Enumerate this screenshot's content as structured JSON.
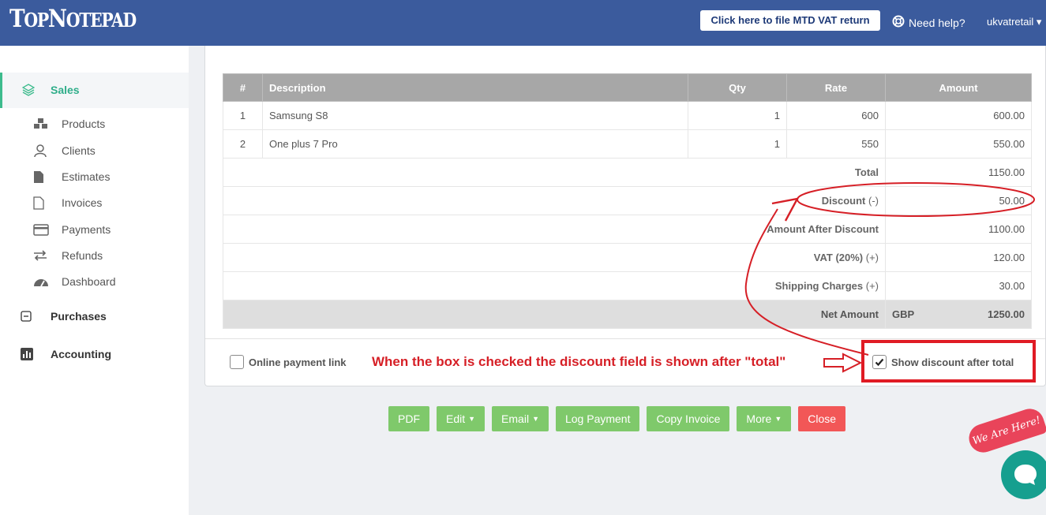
{
  "header": {
    "logo_big": "T",
    "logo_small1": "OP",
    "logo_big2": "N",
    "logo_small2": "OTEPAD",
    "mtd_button": "Click here to file MTD VAT return",
    "help": "Need help?",
    "user": "ukvatretail"
  },
  "sidebar": {
    "active": "Sales",
    "items": [
      {
        "label": "Products",
        "icon": "cubes-icon"
      },
      {
        "label": "Clients",
        "icon": "user-icon"
      },
      {
        "label": "Estimates",
        "icon": "file-icon"
      },
      {
        "label": "Invoices",
        "icon": "file-outline-icon"
      },
      {
        "label": "Payments",
        "icon": "credit-card-icon"
      },
      {
        "label": "Refunds",
        "icon": "exchange-icon"
      },
      {
        "label": "Dashboard",
        "icon": "dashboard-icon"
      }
    ],
    "sections": [
      {
        "label": "Purchases",
        "icon": "minus-square-icon"
      },
      {
        "label": "Accounting",
        "icon": "bar-chart-icon"
      }
    ]
  },
  "table": {
    "headers": {
      "num": "#",
      "desc": "Description",
      "qty": "Qty",
      "rate": "Rate",
      "amount": "Amount"
    },
    "rows": [
      {
        "num": "1",
        "desc": "Samsung S8",
        "qty": "1",
        "rate": "600",
        "amount": "600.00"
      },
      {
        "num": "2",
        "desc": "One plus 7 Pro",
        "qty": "1",
        "rate": "550",
        "amount": "550.00"
      }
    ],
    "summary": [
      {
        "label": "Total",
        "sign": "",
        "value": "1150.00"
      },
      {
        "label": "Discount",
        "sign": "(-)",
        "value": "50.00"
      },
      {
        "label": "Amount After Discount",
        "sign": "",
        "value": "1100.00"
      },
      {
        "label": "VAT (20%)",
        "sign": "(+)",
        "value": "120.00"
      },
      {
        "label": "Shipping Charges",
        "sign": "(+)",
        "value": "30.00"
      }
    ],
    "net": {
      "label": "Net Amount",
      "currency": "GBP",
      "value": "1250.00"
    }
  },
  "options": {
    "online_payment": "Online payment link",
    "online_checked": false,
    "show_discount": "Show discount after total",
    "show_discount_checked": true
  },
  "annotation": "When the box is checked the discount field is shown after \"total\"",
  "actions": {
    "pdf": "PDF",
    "edit": "Edit",
    "email": "Email",
    "log_payment": "Log Payment",
    "copy_invoice": "Copy Invoice",
    "more": "More",
    "close": "Close"
  },
  "chat": {
    "badge": "We Are Here!"
  },
  "colors": {
    "header": "#3b5b9d",
    "accent": "#3dbb8d",
    "button": "#7fc96b",
    "close": "#f25757",
    "annotation": "#d61f26"
  }
}
